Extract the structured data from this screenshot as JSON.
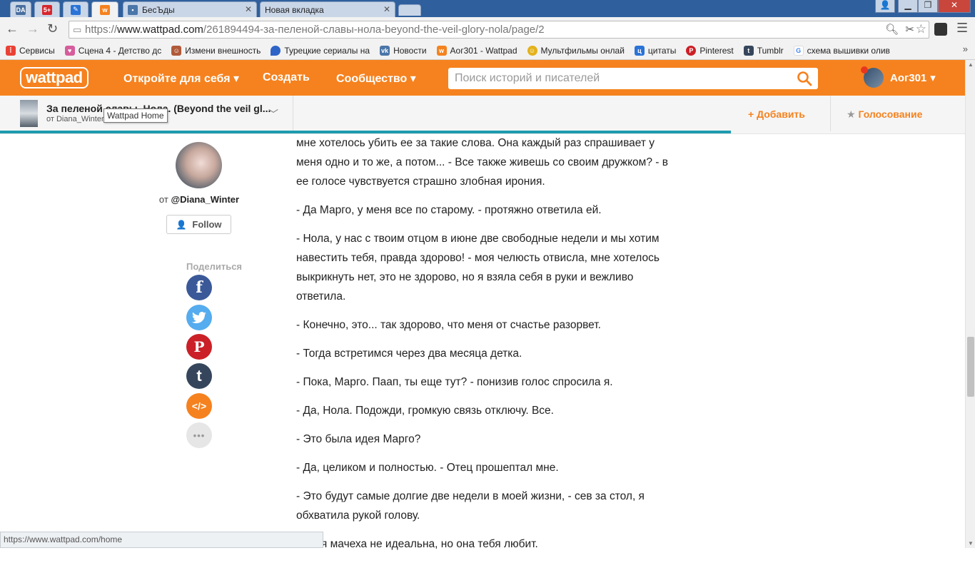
{
  "browser": {
    "tabs": [
      {
        "label": "",
        "icon": "da-icon",
        "color": "#4a6f9e"
      },
      {
        "label": "",
        "icon": "five-plus-icon",
        "color": "#d7262c"
      },
      {
        "label": "",
        "icon": "feather-icon",
        "color": "#2b73d6"
      },
      {
        "label": "",
        "icon": "wattpad-icon",
        "color": "#f5821f"
      },
      {
        "label": "БесЪды",
        "icon": "chat-icon",
        "color": "#4a76a8"
      },
      {
        "label": "Новая вкладка",
        "icon": "",
        "color": ""
      }
    ],
    "url_prefix": "https://",
    "url_host": "www.wattpad.com",
    "url_path": "/261894494-за-пеленой-славы-нола-beyond-the-veil-glory-nola/page/2",
    "bookmarks": [
      {
        "label": "Сервисы",
        "icon": "apps-grid-icon",
        "color": "#e94235"
      },
      {
        "label": "Сцена 4 - Детство дс",
        "icon": "heart-icon",
        "color": "#d65d9c"
      },
      {
        "label": "Измени внешность",
        "icon": "face-icon",
        "color": "#b05a3a"
      },
      {
        "label": "Турецкие сериалы на",
        "icon": "drop-icon",
        "color": "#2e64c7"
      },
      {
        "label": "Новости",
        "icon": "vk-icon",
        "color": "#4a76a8"
      },
      {
        "label": "Аог301 - Wattpad",
        "icon": "wattpad-icon",
        "color": "#f5821f"
      },
      {
        "label": "Мультфильмы онлай",
        "icon": "smile-icon",
        "color": "#e3b21c"
      },
      {
        "label": "цитаты",
        "icon": "c-icon",
        "color": "#2b73d6"
      },
      {
        "label": "Pinterest",
        "icon": "pinterest-icon",
        "color": "#cb2027"
      },
      {
        "label": "Tumblr",
        "icon": "tumblr-icon",
        "color": "#35465c"
      },
      {
        "label": "схема вышивки олив",
        "icon": "google-icon",
        "color": "#4285f4"
      }
    ]
  },
  "header": {
    "logo": "wattpad",
    "nav": {
      "discover": "Откройте для себя",
      "create": "Создать",
      "community": "Сообщество"
    },
    "search_placeholder": "Поиск историй и писателей",
    "username": "Аог301"
  },
  "story_bar": {
    "title": "За пеленой славы. Нола. (Beyond the veil gl...",
    "author": "от Diana_Winter",
    "tooltip": "Wattpad Home",
    "add_label": "Добавить",
    "vote_label": "Голосование"
  },
  "sidebar": {
    "author_prefix": "от",
    "author_handle": "@Diana_Winter",
    "follow_label": "Follow",
    "share_label": "Поделиться",
    "share_buttons": [
      {
        "name": "facebook",
        "color": "#3b5998",
        "glyph": "f"
      },
      {
        "name": "twitter",
        "color": "#55acee",
        "glyph": ""
      },
      {
        "name": "pinterest",
        "color": "#cb2027",
        "glyph": "P"
      },
      {
        "name": "tumblr",
        "color": "#35465c",
        "glyph": "t"
      },
      {
        "name": "embed",
        "color": "#f5821f",
        "glyph": "</>"
      },
      {
        "name": "more",
        "color": "#e6e6e6",
        "glyph": "•••"
      }
    ]
  },
  "story_paragraphs": [
    "мне хотелось убить ее за такие слова. Она каждый раз спрашивает у меня одно и то же, а потом... - Все также живешь со своим дружком? - в ее голосе чувствуется страшно злобная ирония.",
    "- Да Марго, у меня все по старому. - протяжно ответила ей.",
    "- Нола, у нас с твоим отцом в июне две свободные недели и мы хотим навестить тебя, правда здорово! - моя челюсть отвисла, мне хотелось выкрикнуть нет, это не здорово, но я взяла себя в руки и вежливо ответила.",
    "- Конечно, это... так здорово, что меня от счастье разорвет.",
    "- Тогда встретимся через два месяца детка.",
    "- Пока, Марго. Паап, ты еще тут? - понизив голос спросила я.",
    "- Да, Нола. Подожди, громкую связь отключу. Все.",
    "- Это была идея Марго?",
    "- Да, целиком и полностью. - Отец прошептал мне.",
    "- Это будут самые долгие две недели в моей жизни, - сев за стол, я обхватила рукой голову.",
    "- Твоя мачеха не идеальна, но она тебя любит."
  ],
  "status_url": "https://www.wattpad.com/home",
  "colors": {
    "brand": "#f5821f",
    "progress": "#1d9bb0"
  }
}
